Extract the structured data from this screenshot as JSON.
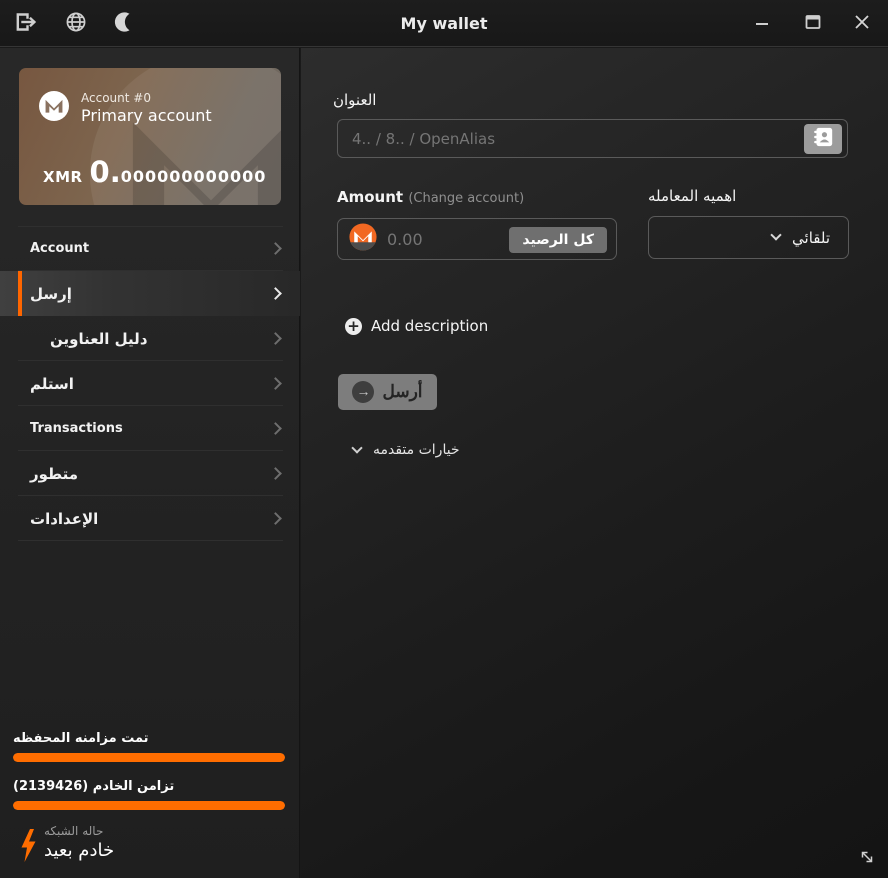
{
  "window": {
    "title": "My wallet"
  },
  "sidebar": {
    "account_card": {
      "account_index": "Account #0",
      "account_name": "Primary account",
      "currency": "XMR",
      "balance_whole": "0.",
      "balance_decimals": "000000000000"
    },
    "menu": [
      {
        "label": "Account"
      },
      {
        "label": "إرسل"
      },
      {
        "label": "دليل العناوين"
      },
      {
        "label": "استلم"
      },
      {
        "label": "Transactions"
      },
      {
        "label": "متطور"
      },
      {
        "label": "الإعدادات"
      }
    ],
    "status": {
      "wallet_sync_label": "تمت مزامنه المحفظه",
      "wallet_sync_progress": 100,
      "daemon_sync_label": "تزامن الخادم (2139426)",
      "daemon_sync_progress": 100,
      "network_status_label": "حاله الشبكه",
      "network_status_value": "خادم بعيد"
    }
  },
  "main": {
    "address": {
      "label": "العنوان",
      "placeholder": "4.. / 8.. / OpenAlias"
    },
    "amount": {
      "label": "Amount",
      "change_account_label": "(Change account)",
      "placeholder": "0.00",
      "all_balance_button": "كل الرصيد"
    },
    "priority": {
      "label": "اهميه المعامله",
      "selected": "تلقائي"
    },
    "add_description_label": "Add description",
    "send_button_label": "أرسل",
    "advanced_options_label": "خيارات متقدمه",
    "send_arrow_glyph": "→"
  },
  "colors": {
    "accent_orange": "#ff6d00",
    "monero_orange": "#f26822",
    "active_item_border": "#ff6600"
  }
}
